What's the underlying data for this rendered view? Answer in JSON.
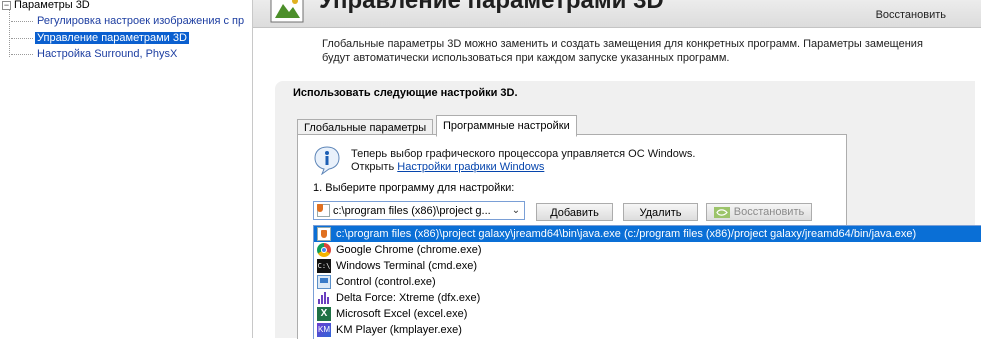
{
  "tree": {
    "root": "Параметры 3D",
    "items": [
      {
        "label": "Регулировка настроек изображения с пр"
      },
      {
        "label": "Управление параметрами 3D"
      },
      {
        "label": "Настройка Surround, PhysX"
      }
    ]
  },
  "header": {
    "title": "Управление параметрами 3D",
    "restore": "Восстановить"
  },
  "description": {
    "line1": "Глобальные параметры 3D можно заменить и создать замещения для конкретных программ. Параметры замещения",
    "line2": "будут автоматически использоваться при каждом запуске указанных программ."
  },
  "panel": {
    "title": "Использовать следующие настройки 3D.",
    "tabs": [
      {
        "label": "Глобальные параметры"
      },
      {
        "label": "Программные настройки"
      }
    ],
    "info": {
      "line1": "Теперь выбор графического процессора управляется ОС Windows.",
      "open_prefix": "Открыть",
      "link": "Настройки графики Windows"
    },
    "step1": "1. Выберите программу для настройки:",
    "combo_value": "c:\\program files (x86)\\project g...",
    "buttons": {
      "add": "Добавить",
      "remove": "Удалить",
      "restore": "Восстановить"
    }
  },
  "dropdown": {
    "options": [
      {
        "label": "c:\\program files (x86)\\project galaxy\\jreamd64\\bin\\java.exe (c:/program files (x86)/project galaxy/jreamd64/bin/java.exe)",
        "icon": "java-icon"
      },
      {
        "label": "Google Chrome (chrome.exe)",
        "icon": "chrome-icon"
      },
      {
        "label": "Windows Terminal (cmd.exe)",
        "icon": "cmd-icon"
      },
      {
        "label": "Control (control.exe)",
        "icon": "control-panel-icon"
      },
      {
        "label": "Delta Force: Xtreme (dfx.exe)",
        "icon": "dfx-icon"
      },
      {
        "label": "Microsoft Excel (excel.exe)",
        "icon": "excel-icon"
      },
      {
        "label": "KM Player (kmplayer.exe)",
        "icon": "kmplayer-icon"
      }
    ],
    "selected_index": 0
  },
  "colors": {
    "selection": "#0a6fd6",
    "tree_link": "#1d3ea1",
    "nvidia_green": "#76b900"
  }
}
